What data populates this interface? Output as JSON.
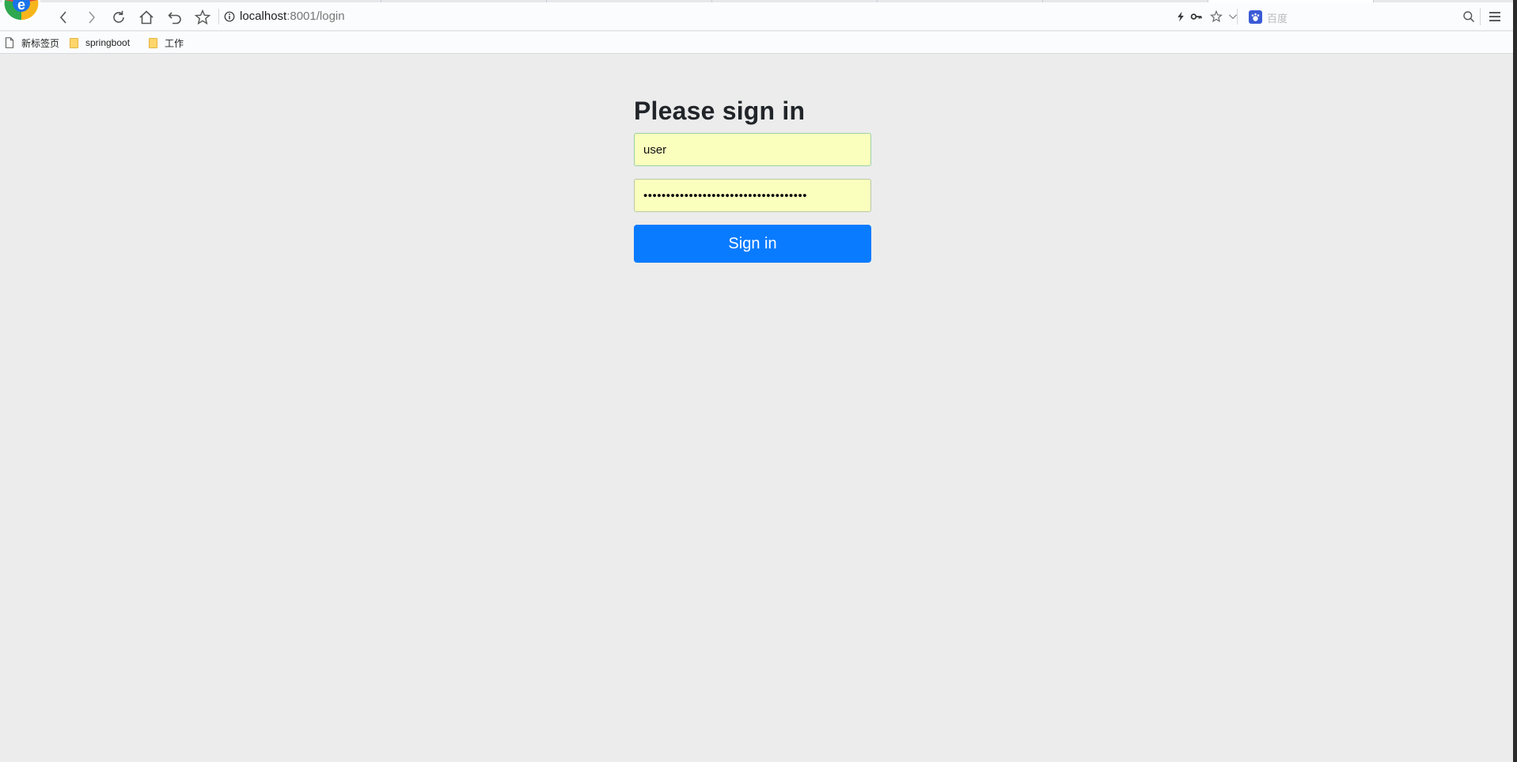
{
  "browser": {
    "url_host": "localhost",
    "url_rest": ":8001/login",
    "search_engine_placeholder": "百度",
    "icons": [
      "browser-logo",
      "back-icon",
      "forward-icon",
      "reload-icon",
      "home-icon",
      "undo-icon",
      "star-icon",
      "info-icon",
      "lightning-icon",
      "key-icon",
      "star-outline-icon",
      "chevron-down-icon",
      "baidu-icon",
      "search-icon",
      "menu-icon"
    ]
  },
  "bookmarks": [
    {
      "label": "新标签页",
      "icon": "page-icon"
    },
    {
      "label": "springboot",
      "icon": "folder-icon"
    },
    {
      "label": "工作",
      "icon": "folder-icon"
    }
  ],
  "login": {
    "heading": "Please sign in",
    "username_value": "user",
    "password_value": "••••••••••••••••••••••••••••••••••••",
    "submit_label": "Sign in",
    "accent_color": "#097bff",
    "autofill_color": "#faffbd"
  }
}
